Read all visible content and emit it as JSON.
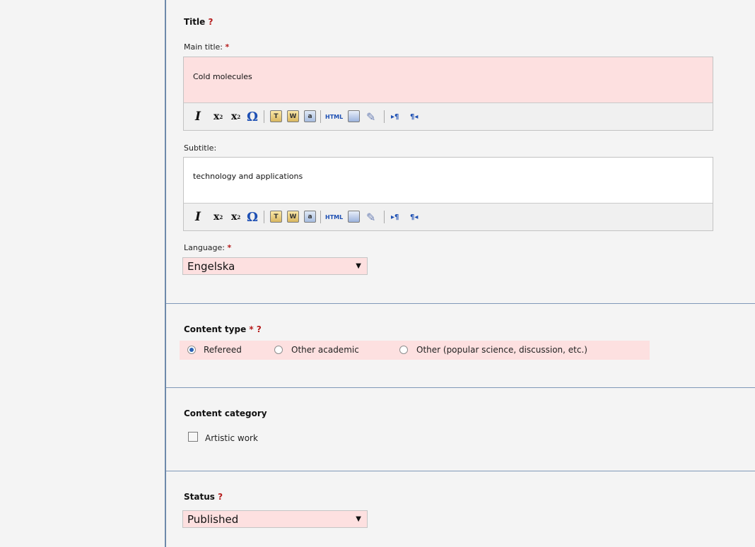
{
  "title_section": {
    "heading": "Title",
    "help": "?",
    "main_title": {
      "label": "Main title:",
      "required": "*",
      "value": "Cold molecules"
    },
    "subtitle": {
      "label": "Subtitle:",
      "value": "technology and applications"
    },
    "language": {
      "label": "Language:",
      "required": "*",
      "value": "Engelska"
    }
  },
  "toolbar": {
    "italic": "I",
    "subscript": "x",
    "subscript_mark": "2",
    "superscript": "x",
    "superscript_mark": "2",
    "special_char": "Ω",
    "html": "HTML",
    "ltr": "▸¶",
    "rtl": "¶◂",
    "icons": [
      "italic-icon",
      "subscript-icon",
      "superscript-icon",
      "omega-icon",
      "paste-text-icon",
      "paste-word-icon",
      "spellcheck-icon",
      "html-source-icon",
      "template-icon",
      "clean-format-icon",
      "ltr-icon",
      "rtl-icon"
    ]
  },
  "content_type": {
    "heading": "Content type",
    "required": "*",
    "help": "?",
    "options": [
      "Refereed",
      "Other academic",
      "Other (popular science, discussion, etc.)"
    ],
    "selected": "Refereed"
  },
  "content_category": {
    "heading": "Content category",
    "checkbox_label": "Artistic work",
    "checked": false
  },
  "status": {
    "heading": "Status",
    "help": "?",
    "value": "Published"
  },
  "colors": {
    "required_pink": "#fde0e0",
    "divider": "#7f98b8",
    "required_mark": "#b51c1c"
  }
}
